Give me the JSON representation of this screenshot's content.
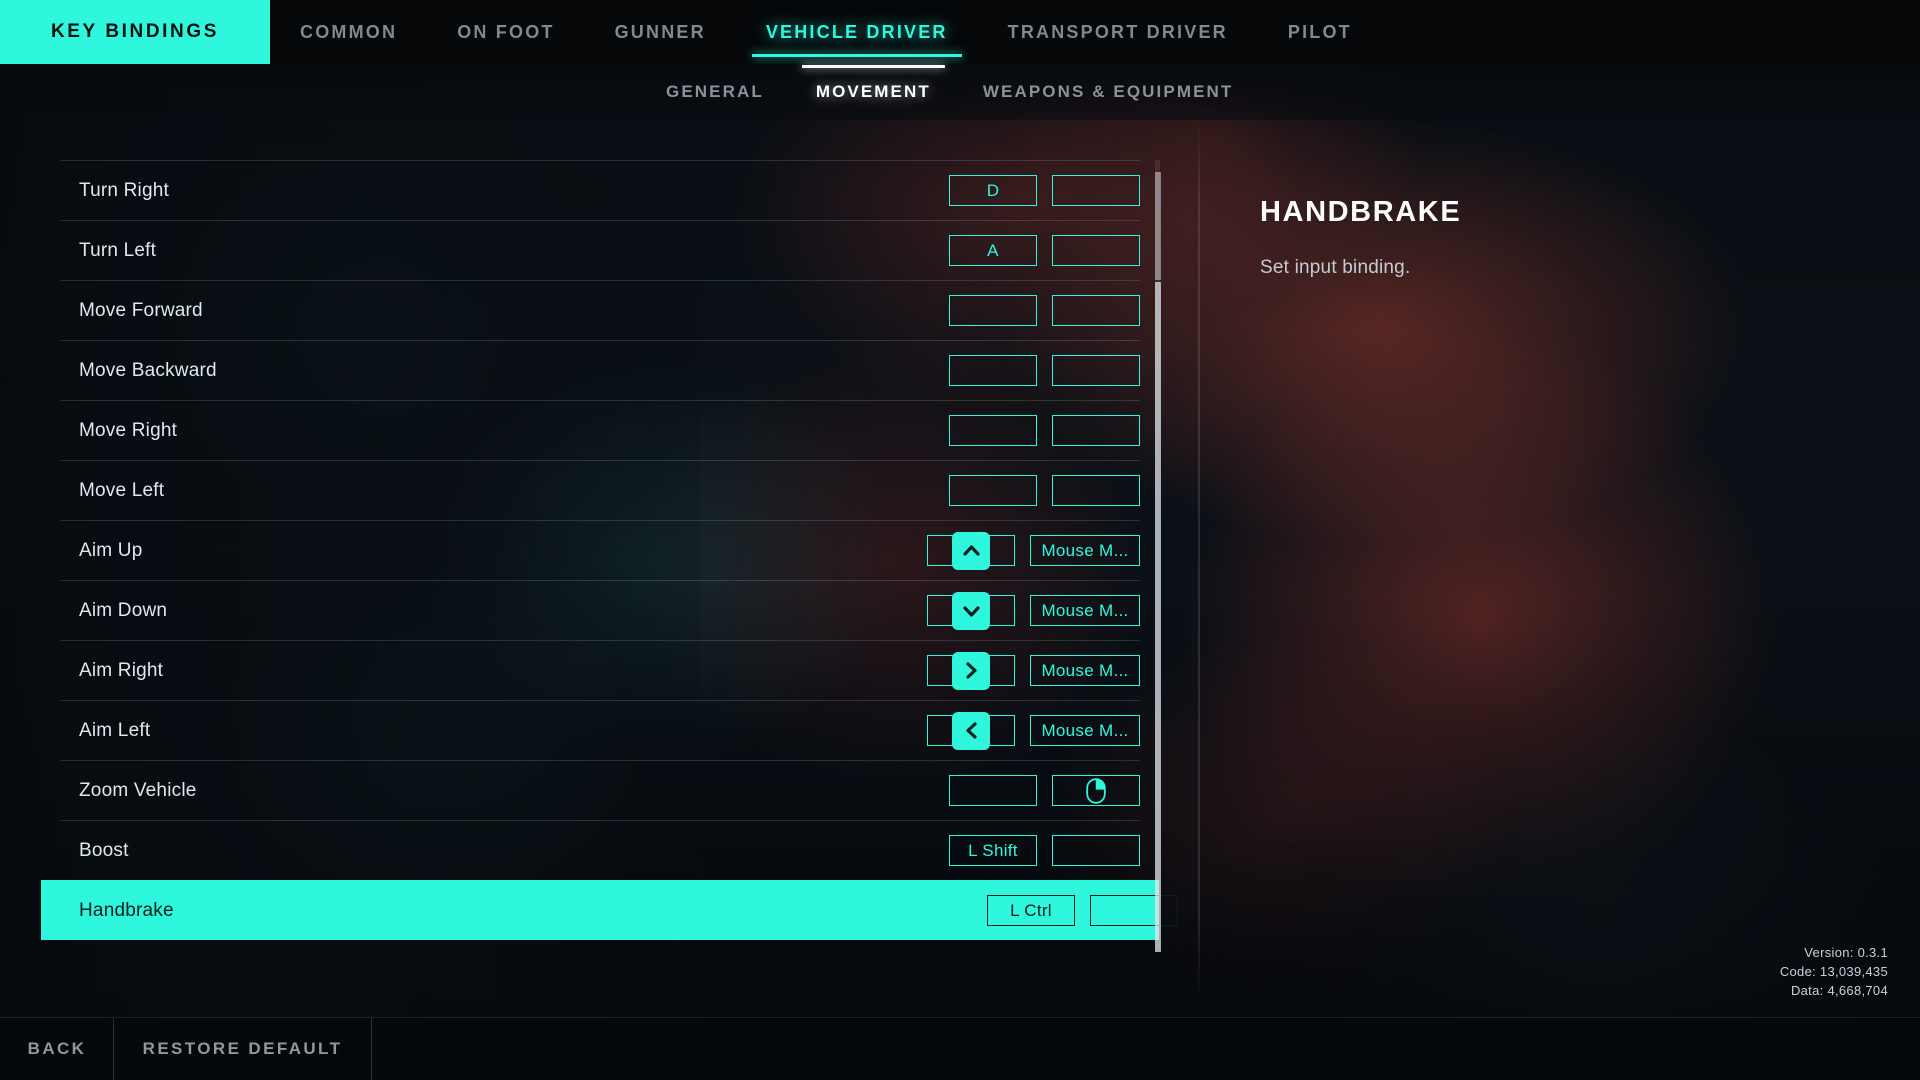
{
  "header": {
    "key_bindings_label": "KEY BINDINGS",
    "tabs": [
      {
        "label": "COMMON",
        "active": false
      },
      {
        "label": "ON FOOT",
        "active": false
      },
      {
        "label": "GUNNER",
        "active": false
      },
      {
        "label": "VEHICLE DRIVER",
        "active": true
      },
      {
        "label": "TRANSPORT DRIVER",
        "active": false
      },
      {
        "label": "PILOT",
        "active": false
      }
    ],
    "subtabs": [
      {
        "label": "GENERAL",
        "active": false
      },
      {
        "label": "MOVEMENT",
        "active": true
      },
      {
        "label": "WEAPONS & EQUIPMENT",
        "active": false
      }
    ]
  },
  "bindings": [
    {
      "action": "Turn Right",
      "primary": "D",
      "primary_icon": "",
      "secondary": "",
      "secondary_icon": "",
      "selected": false
    },
    {
      "action": "Turn Left",
      "primary": "A",
      "primary_icon": "",
      "secondary": "",
      "secondary_icon": "",
      "selected": false
    },
    {
      "action": "Move Forward",
      "primary": "",
      "primary_icon": "",
      "secondary": "",
      "secondary_icon": "",
      "selected": false
    },
    {
      "action": "Move Backward",
      "primary": "",
      "primary_icon": "",
      "secondary": "",
      "secondary_icon": "",
      "selected": false
    },
    {
      "action": "Move Right",
      "primary": "",
      "primary_icon": "",
      "secondary": "",
      "secondary_icon": "",
      "selected": false
    },
    {
      "action": "Move Left",
      "primary": "",
      "primary_icon": "",
      "secondary": "",
      "secondary_icon": "",
      "selected": false
    },
    {
      "action": "Aim Up",
      "primary": "",
      "primary_icon": "chevron-up-key-icon",
      "secondary": "Mouse M...",
      "secondary_icon": "",
      "selected": false
    },
    {
      "action": "Aim Down",
      "primary": "",
      "primary_icon": "chevron-down-key-icon",
      "secondary": "Mouse M...",
      "secondary_icon": "",
      "selected": false
    },
    {
      "action": "Aim Right",
      "primary": "",
      "primary_icon": "chevron-right-key-icon",
      "secondary": "Mouse M...",
      "secondary_icon": "",
      "selected": false
    },
    {
      "action": "Aim Left",
      "primary": "",
      "primary_icon": "chevron-left-key-icon",
      "secondary": "Mouse M...",
      "secondary_icon": "",
      "selected": false
    },
    {
      "action": "Zoom Vehicle",
      "primary": "",
      "primary_icon": "",
      "secondary": "",
      "secondary_icon": "mouse-right-button-icon",
      "selected": false
    },
    {
      "action": "Boost",
      "primary": "L Shift",
      "primary_icon": "",
      "secondary": "",
      "secondary_icon": "",
      "selected": false
    },
    {
      "action": "Handbrake",
      "primary": "L Ctrl",
      "primary_icon": "",
      "secondary": "",
      "secondary_icon": "",
      "selected": true
    }
  ],
  "detail": {
    "title": "HANDBRAKE",
    "description": "Set input binding."
  },
  "version_info": {
    "version": "Version: 0.3.1",
    "code": "Code: 13,039,435",
    "data": "Data: 4,668,704"
  },
  "bottom_bar": {
    "buttons": [
      {
        "label": "BACK"
      },
      {
        "label": "RESTORE DEFAULT"
      }
    ]
  },
  "colors": {
    "accent": "#2ff7dd",
    "accent_text_on_fill": "#06221d",
    "row_text": "#dfe8ec",
    "muted_text": "#8a9399",
    "panel_bg": "#050709"
  }
}
